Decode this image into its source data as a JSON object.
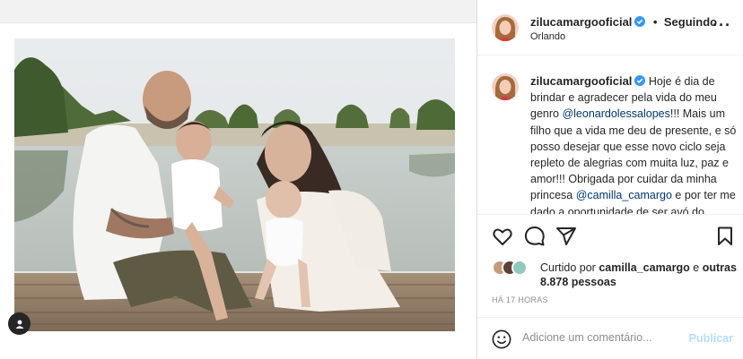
{
  "header": {
    "username": "zilucamargooficial",
    "separator": "•",
    "follow_label": "Seguindo",
    "location": "Orlando"
  },
  "caption": {
    "username": "zilucamargooficial",
    "text_1": "Hoje é dia de brindar e agradecer pela vida do meu genro",
    "mention_1": "@leonardolessalopes",
    "text_2": "!!! Mais um filho que a vida me deu de presente, e só posso desejar que esse novo ciclo seja repleto de alegrias com muita luz, paz e amor!!! Obrigada por cuidar da minha princesa",
    "mention_2": "@camilla_camargo",
    "text_3": "e por ter me dado a oportunidade de ser avó do Joaquim e da Julinha!!! Deus continue"
  },
  "likes": {
    "prefix": "Curtido por",
    "user": "camilla_camargo",
    "joiner": "e",
    "others": "outras 8.878 pessoas"
  },
  "timestamp": "HÁ 17 HORAS",
  "comment": {
    "placeholder": "Adicione um comentário...",
    "publish_label": "Publicar"
  },
  "icons": {
    "verified": "verified-badge-icon",
    "more": "more-options-icon",
    "like": "heart-icon",
    "comment": "comment-icon",
    "share": "share-icon",
    "save": "bookmark-icon",
    "emoji": "emoji-icon",
    "tagged": "user-tag-icon"
  },
  "colors": {
    "verified_blue": "#3897f0",
    "mention": "#00376b",
    "publish_disabled": "#b2dffc",
    "muted": "#8e8e8e"
  }
}
